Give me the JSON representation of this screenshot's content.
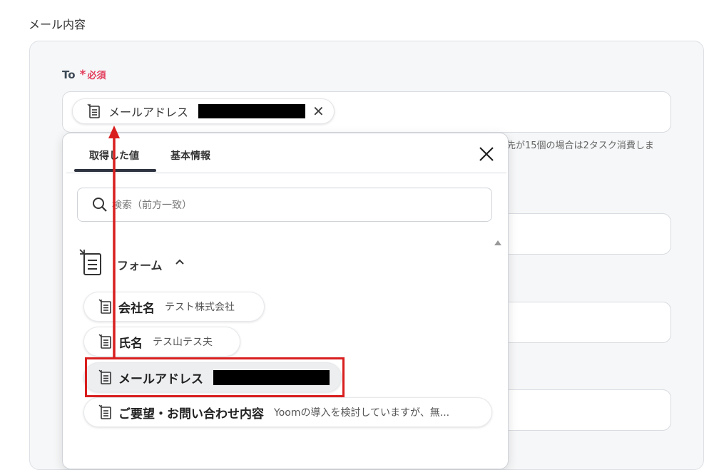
{
  "section_title": "メール内容",
  "to_field": {
    "label": "To",
    "required_star": "*",
    "required_text": "必須",
    "token_label": "メールアドレス",
    "helper_text": "先が15個の場合は2タスク消費しま"
  },
  "popup": {
    "tabs": [
      {
        "label": "取得した値",
        "active": true
      },
      {
        "label": "基本情報",
        "active": false
      }
    ],
    "search_placeholder": "検索（前方一致）",
    "group": {
      "label": "フォーム",
      "expanded": true
    },
    "items": [
      {
        "name": "会社名",
        "value": "テスト株式会社"
      },
      {
        "name": "氏名",
        "value": "テス山テス夫"
      },
      {
        "name": "メールアドレス",
        "value": ""
      },
      {
        "name": "ご要望・お問い合わせ内容",
        "value": "Yoomの導入を検討していますが、無..."
      }
    ]
  },
  "annotation": {
    "color": "#d91e1e"
  }
}
